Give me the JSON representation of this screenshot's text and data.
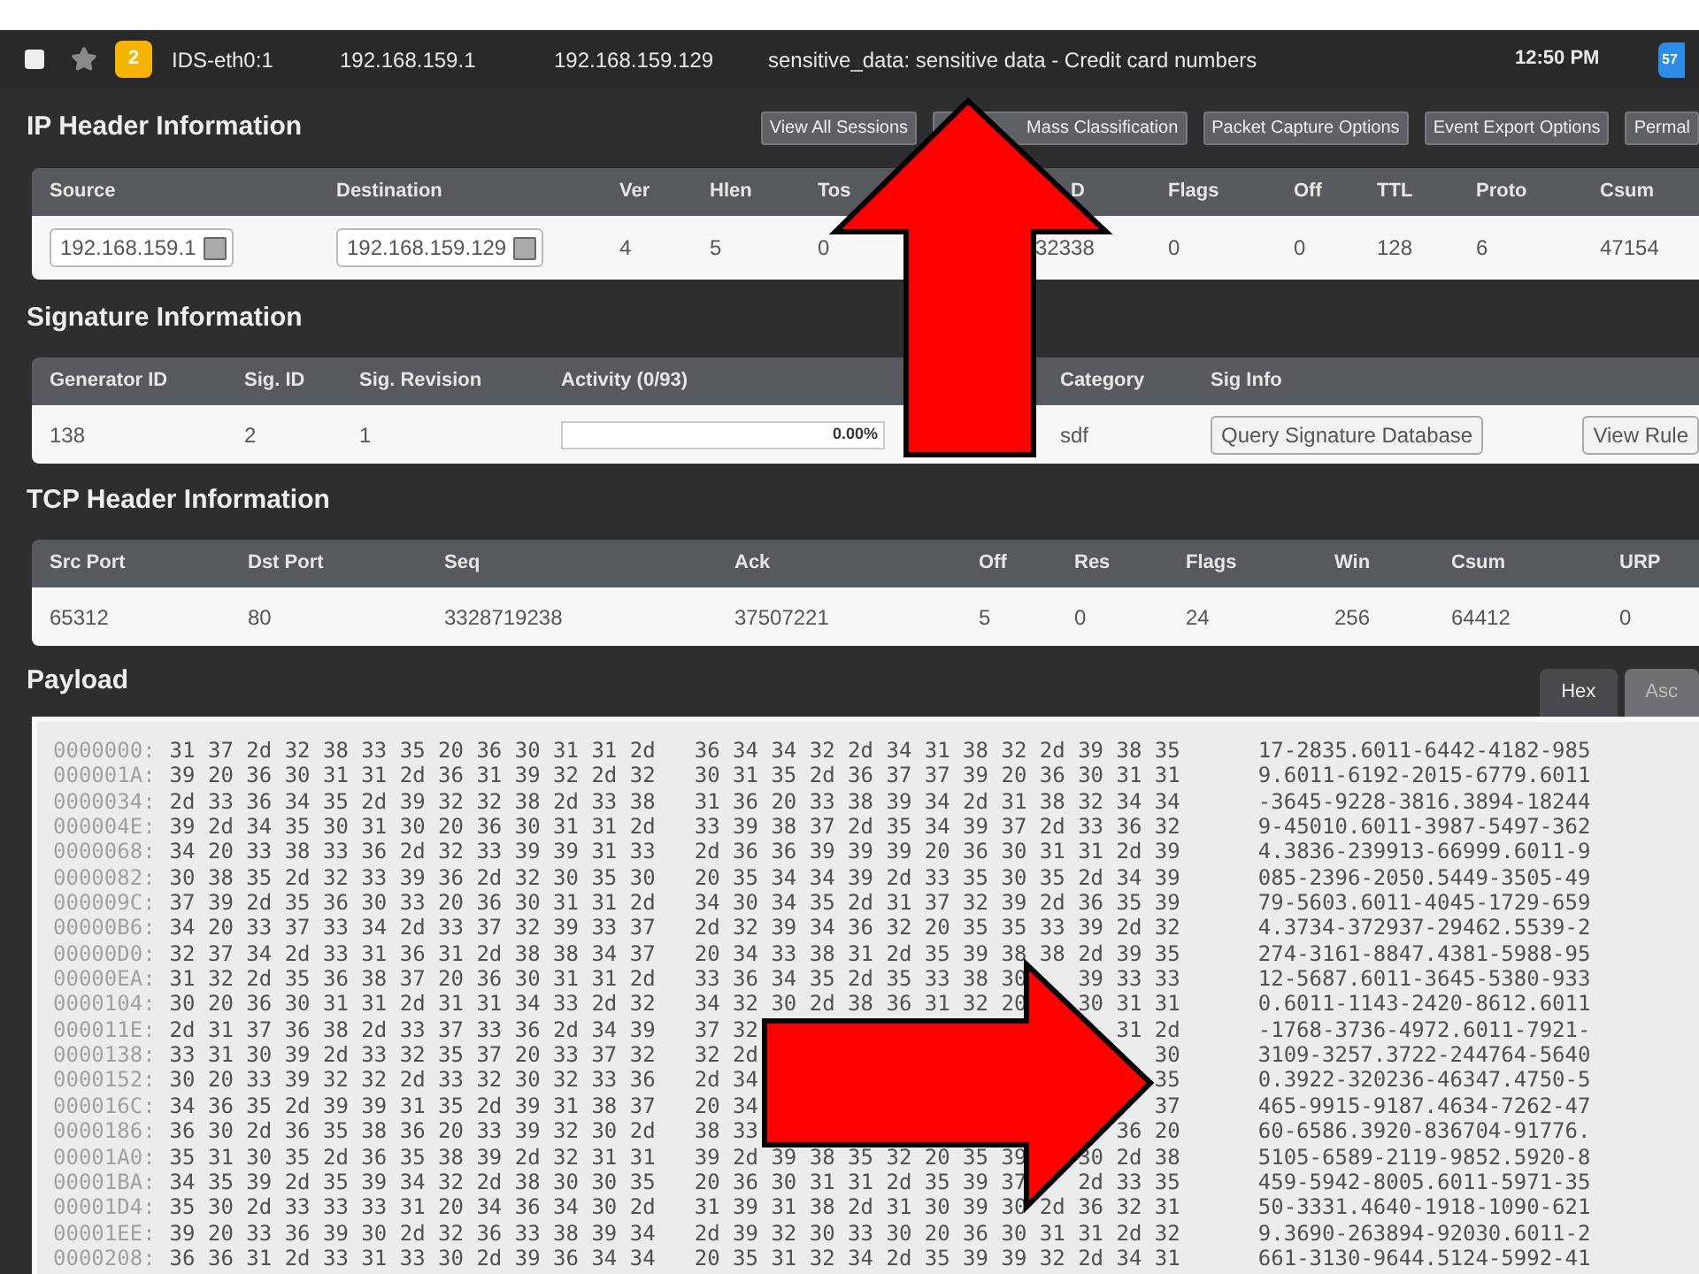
{
  "event_bar": {
    "checked": false,
    "starred": false,
    "count": "2",
    "sensor": "IDS-eth0:1",
    "source_ip": "192.168.159.1",
    "destination_ip": "192.168.159.129",
    "message": "sensitive_data: sensitive data - Credit card numbers",
    "time": "12:50 PM",
    "badge": "57"
  },
  "ip_header": {
    "title": "IP Header Information",
    "buttons": [
      "View All Sessions",
      "Mass Classification",
      "Packet Capture Options",
      "Event Export Options",
      "Permal"
    ],
    "columns": [
      "Source",
      "Destination",
      "Ver",
      "Hlen",
      "Tos",
      "D",
      "Flags",
      "Off",
      "TTL",
      "Proto",
      "Csum"
    ],
    "cells": [
      {
        "kind": "field",
        "value": "192.168.159.1"
      },
      {
        "kind": "field",
        "value": "192.168.159.129"
      },
      {
        "kind": "text",
        "value": "4"
      },
      {
        "kind": "text",
        "value": "5"
      },
      {
        "kind": "text",
        "value": "0"
      },
      {
        "kind": "text",
        "value": "32338"
      },
      {
        "kind": "text",
        "value": "0"
      },
      {
        "kind": "text",
        "value": "0"
      },
      {
        "kind": "text",
        "value": "128"
      },
      {
        "kind": "text",
        "value": "6"
      },
      {
        "kind": "text",
        "value": "47154"
      }
    ]
  },
  "signature": {
    "title": "Signature Information",
    "columns": [
      "Generator ID",
      "Sig. ID",
      "Sig. Revision",
      "Activity (0/93)",
      "Category",
      "Sig Info"
    ],
    "cells": [
      {
        "kind": "text",
        "value": "138"
      },
      {
        "kind": "text",
        "value": "2"
      },
      {
        "kind": "text",
        "value": "1"
      },
      {
        "kind": "meter",
        "level": 0,
        "reading": "0.00%"
      },
      {
        "kind": "text",
        "value": "sdf"
      },
      {
        "kind": "buttons",
        "buttons": [
          "Query Signature Database",
          "View Rule"
        ]
      }
    ]
  },
  "tcp_header": {
    "title": "TCP Header Information",
    "columns": [
      "Src Port",
      "Dst Port",
      "Seq",
      "Ack",
      "Off",
      "Res",
      "Flags",
      "Win",
      "Csum",
      "URP"
    ],
    "cells": [
      {
        "kind": "text",
        "value": "65312"
      },
      {
        "kind": "text",
        "value": "80"
      },
      {
        "kind": "text",
        "value": "3328719238"
      },
      {
        "kind": "text",
        "value": "37507221"
      },
      {
        "kind": "text",
        "value": "5"
      },
      {
        "kind": "text",
        "value": "0"
      },
      {
        "kind": "text",
        "value": "24"
      },
      {
        "kind": "text",
        "value": "256"
      },
      {
        "kind": "text",
        "value": "64412"
      },
      {
        "kind": "text",
        "value": "0"
      }
    ]
  },
  "payload": {
    "title": "Payload",
    "tabs": [
      {
        "label": "Hex",
        "selected": true
      },
      {
        "label": "Asc",
        "selected": false
      }
    ],
    "rows": [
      {
        "offset": "0000000:",
        "hex_left": "31 37 2d 32 38 33 35 20 36 30 31 31 2d",
        "hex_right": "36 34 34 32 2d 34 31 38 32 2d 39 38 35",
        "ascii": "17-2835.6011-6442-4182-985"
      },
      {
        "offset": "000001A:",
        "hex_left": "39 20 36 30 31 31 2d 36 31 39 32 2d 32",
        "hex_right": "30 31 35 2d 36 37 37 39 20 36 30 31 31",
        "ascii": "9.6011-6192-2015-6779.6011"
      },
      {
        "offset": "0000034:",
        "hex_left": "2d 33 36 34 35 2d 39 32 32 38 2d 33 38",
        "hex_right": "31 36 20 33 38 39 34 2d 31 38 32 34 34",
        "ascii": "-3645-9228-3816.3894-18244"
      },
      {
        "offset": "000004E:",
        "hex_left": "39 2d 34 35 30 31 30 20 36 30 31 31 2d",
        "hex_right": "33 39 38 37 2d 35 34 39 37 2d 33 36 32",
        "ascii": "9-45010.6011-3987-5497-362"
      },
      {
        "offset": "0000068:",
        "hex_left": "34 20 33 38 33 36 2d 32 33 39 39 31 33",
        "hex_right": "2d 36 36 39 39 39 20 36 30 31 31 2d 39",
        "ascii": "4.3836-239913-66999.6011-9"
      },
      {
        "offset": "0000082:",
        "hex_left": "30 38 35 2d 32 33 39 36 2d 32 30 35 30",
        "hex_right": "20 35 34 34 39 2d 33 35 30 35 2d 34 39",
        "ascii": "085-2396-2050.5449-3505-49"
      },
      {
        "offset": "000009C:",
        "hex_left": "37 39 2d 35 36 30 33 20 36 30 31 31 2d",
        "hex_right": "34 30 34 35 2d 31 37 32 39 2d 36 35 39",
        "ascii": "79-5603.6011-4045-1729-659"
      },
      {
        "offset": "00000B6:",
        "hex_left": "34 20 33 37 33 34 2d 33 37 32 39 33 37",
        "hex_right": "2d 32 39 34 36 32 20 35 35 33 39 2d 32",
        "ascii": "4.3734-372937-29462.5539-2"
      },
      {
        "offset": "00000D0:",
        "hex_left": "32 37 34 2d 33 31 36 31 2d 38 38 34 37",
        "hex_right": "20 34 33 38 31 2d 35 39 38 38 2d 39 35",
        "ascii": "274-3161-8847.4381-5988-95"
      },
      {
        "offset": "00000EA:",
        "hex_left": "31 32 2d 35 36 38 37 20 36 30 31 31 2d",
        "hex_right": "33 36 34 35 2d 35 33 38 30",
        "hex_right_end": "39 33 33",
        "ascii": "12-5687.6011-3645-5380-933"
      },
      {
        "offset": "0000104:",
        "hex_left": "30 20 36 30 31 31 2d 31 31 34 33 2d 32",
        "hex_right": "34 32 30 2d 38 36 31 32 20",
        "hex_right_end": "30 31 31",
        "ascii": "0.6011-1143-2420-8612.6011"
      },
      {
        "offset": "000011E:",
        "hex_left": "2d 31 37 36 38 2d 33 37 33 36 2d 34 39",
        "hex_right": "37 32",
        "hex_right_end": "31 2d",
        "ascii": "-1768-3736-4972.6011-7921-"
      },
      {
        "offset": "0000138:",
        "hex_left": "33 31 30 39 2d 33 32 35 37 20 33 37 32",
        "hex_right": "32 2d",
        "hex_right_end": "30",
        "ascii": "3109-3257.3722-244764-5640"
      },
      {
        "offset": "0000152:",
        "hex_left": "30 20 33 39 32 32 2d 33 32 30 32 33 36",
        "hex_right": "2d 34",
        "hex_right_end": "35",
        "ascii": "0.3922-320236-46347.4750-5"
      },
      {
        "offset": "000016C:",
        "hex_left": "34 36 35 2d 39 39 31 35 2d 39 31 38 37",
        "hex_right": "20 34",
        "hex_right_end": "37",
        "ascii": "465-9915-9187.4634-7262-47"
      },
      {
        "offset": "0000186:",
        "hex_left": "36 30 2d 36 35 38 36 20 33 39 32 30 2d",
        "hex_right": "38 33",
        "hex_right_end": "36 20",
        "ascii": "60-6586.3920-836704-91776."
      },
      {
        "offset": "00001A0:",
        "hex_left": "35 31 30 35 2d 36 35 38 39 2d 32 31 31",
        "hex_right": "39 2d 39 38 35 32 20 35 39",
        "hex_right_end": "30 2d 38",
        "ascii": "5105-6589-2119-9852.5920-8"
      },
      {
        "offset": "00001BA:",
        "hex_left": "34 35 39 2d 35 39 34 32 2d 38 30 30 35",
        "hex_right": "20 36 30 31 31 2d 35 39 37",
        "hex_right_end": "2d 33 35",
        "ascii": "459-5942-8005.6011-5971-35"
      },
      {
        "offset": "00001D4:",
        "hex_left": "35 30 2d 33 33 33 31 20 34 36 34 30 2d",
        "hex_right": "31 39 31 38 2d 31 30 39 30 2d 36 32 31",
        "ascii": "50-3331.4640-1918-1090-621"
      },
      {
        "offset": "00001EE:",
        "hex_left": "39 20 33 36 39 30 2d 32 36 33 38 39 34",
        "hex_right": "2d 39 32 30 33 30 20 36 30 31 31 2d 32",
        "ascii": "9.3690-263894-92030.6011-2"
      },
      {
        "offset": "0000208:",
        "hex_left": "36 36 31 2d 33 31 33 30 2d 39 36 34 34",
        "hex_right": "20 35 31 32 34 2d 35 39 39 32 2d 34 31",
        "ascii": "661-3130-9644.5124-5992-41"
      }
    ]
  }
}
